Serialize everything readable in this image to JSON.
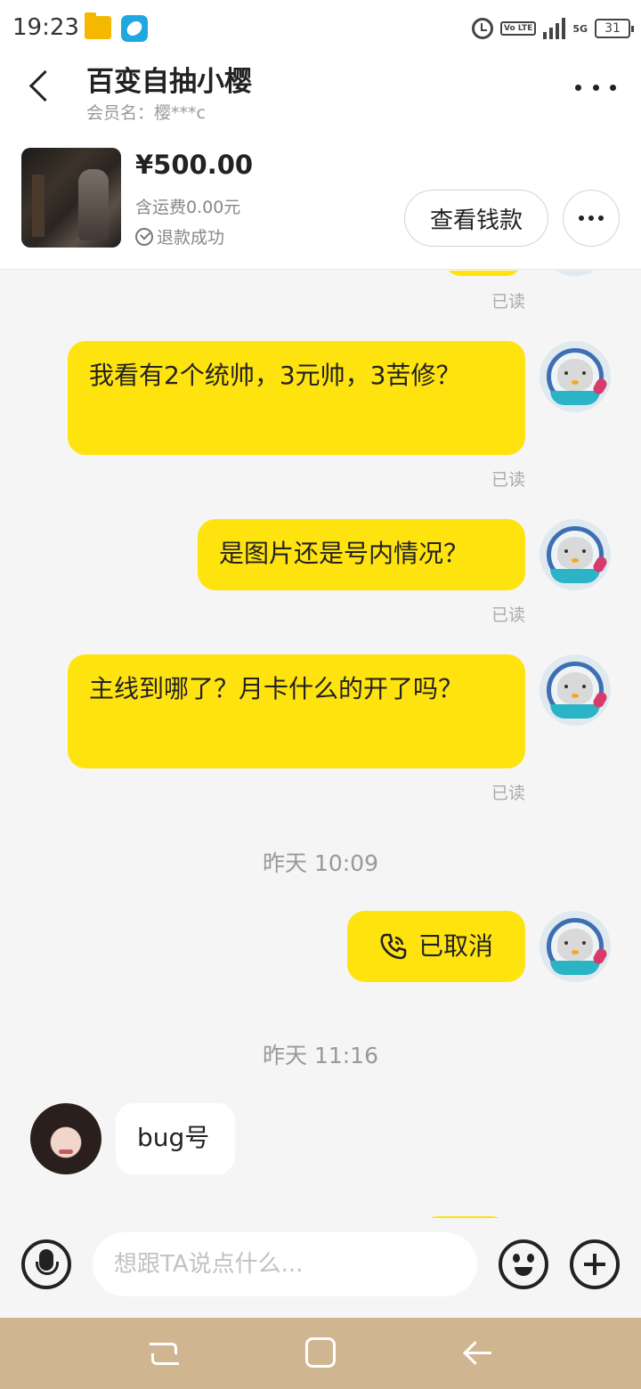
{
  "status_bar": {
    "time": "19:23",
    "volte": "Vo LTE",
    "network": "5G",
    "battery": "31"
  },
  "header": {
    "title": "百变自抽小樱",
    "subtitle": "会员名：樱***c"
  },
  "product": {
    "price": "¥500.00",
    "shipping": "含运费0.00元",
    "refund_status": "退款成功",
    "view_button": "查看钱款"
  },
  "messages": [
    {
      "read_label": "已读"
    },
    {
      "text": "我看有2个统帅，3元帅，3苦修？",
      "read_label": "已读"
    },
    {
      "text": "是图片还是号内情况？",
      "read_label": "已读"
    },
    {
      "text": "主线到哪了？月卡什么的开了吗？",
      "read_label": "已读"
    },
    {
      "timestamp": "昨天 10:09"
    },
    {
      "text": "已取消",
      "type": "call"
    },
    {
      "timestamp": "昨天 11:16"
    },
    {
      "text": "bug号",
      "direction": "incoming"
    }
  ],
  "input": {
    "placeholder": "想跟TA说点什么..."
  },
  "colors": {
    "bubble_outgoing": "#ffe30f",
    "bubble_incoming": "#ffffff",
    "background": "#f5f5f5",
    "nav_bar": "#cfb691"
  }
}
